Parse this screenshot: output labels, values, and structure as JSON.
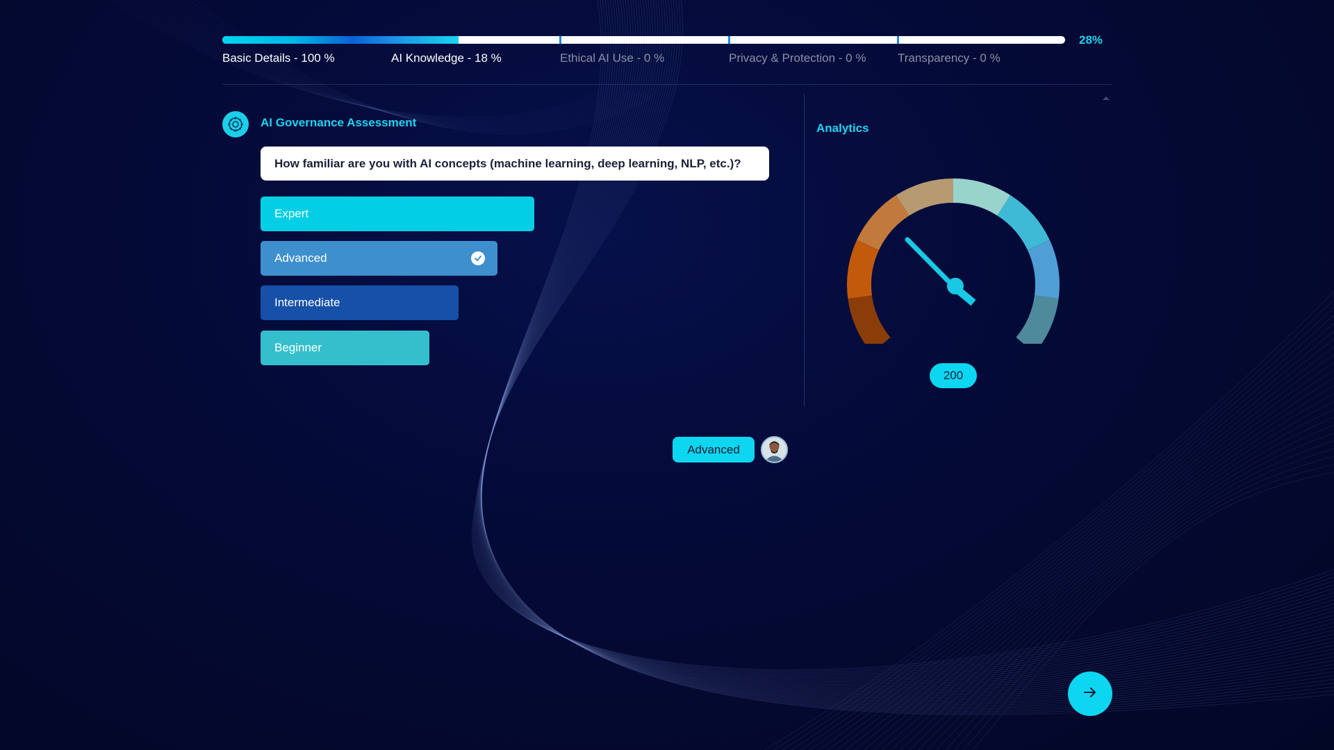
{
  "progress": {
    "percent": 28,
    "percent_label": "28%",
    "stages": [
      {
        "label": "Basic Details - 100 %",
        "value": 100,
        "state": "active"
      },
      {
        "label": "AI Knowledge - 18 %",
        "value": 18,
        "state": "active"
      },
      {
        "label": "Ethical AI Use - 0 %",
        "value": 0,
        "state": "inactive"
      },
      {
        "label": "Privacy & Protection - 0 %",
        "value": 0,
        "state": "inactive"
      },
      {
        "label": "Transparency - 0 %",
        "value": 0,
        "state": "inactive"
      }
    ]
  },
  "assessment": {
    "title": "AI Governance Assessment",
    "logo_icon": "ai-brain-icon",
    "question": "How familiar are you with AI concepts (machine learning, deep learning, NLP, etc.)?",
    "options": [
      {
        "label": "Expert",
        "color": "#02cfe6",
        "selected": false
      },
      {
        "label": "Advanced",
        "color": "#3d8fce",
        "selected": true
      },
      {
        "label": "Intermediate",
        "color": "#1650a8",
        "selected": false
      },
      {
        "label": "Beginner",
        "color": "#35bfcc",
        "selected": false
      }
    ]
  },
  "analytics": {
    "title": "Analytics",
    "gauge_value": "200",
    "segment_colors": [
      "#8a3d08",
      "#c25a0c",
      "#c27a3c",
      "#b89a72",
      "#98d3cc",
      "#3fbad6",
      "#4f9fd6",
      "#4f8a9c"
    ]
  },
  "reply": {
    "label": "Advanced"
  },
  "next_button": {
    "icon": "arrow-right-icon"
  },
  "colors": {
    "accent": "#1fd3f0",
    "background": "#040a36"
  }
}
